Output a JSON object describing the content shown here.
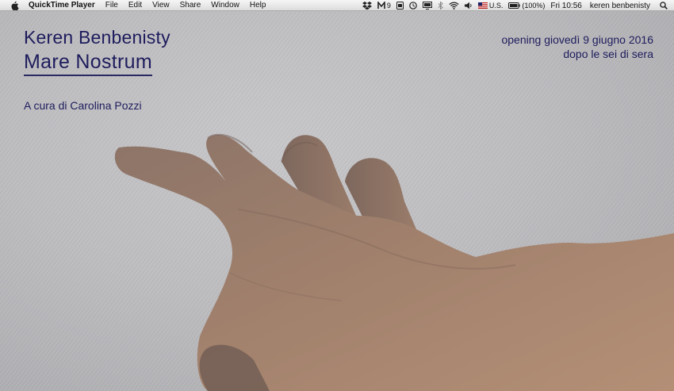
{
  "menubar": {
    "app_name": "QuickTime Player",
    "menus": [
      "File",
      "Edit",
      "View",
      "Share",
      "Window",
      "Help"
    ],
    "status": {
      "notif_count": "9",
      "keyboard": "U.S.",
      "battery": "(100%)",
      "clock": "Fri 10:56",
      "user": "keren benbenisty"
    }
  },
  "poster": {
    "artist": "Keren Benbenisty",
    "title": "Mare Nostrum",
    "curator": "A cura di Carolina Pozzi",
    "opening_line1": "opening giovedì 9 giugno 2016",
    "opening_line2": "dopo le sei di sera"
  },
  "colors": {
    "text": "#1e1c5c",
    "menubar": "#e8e8e8"
  }
}
